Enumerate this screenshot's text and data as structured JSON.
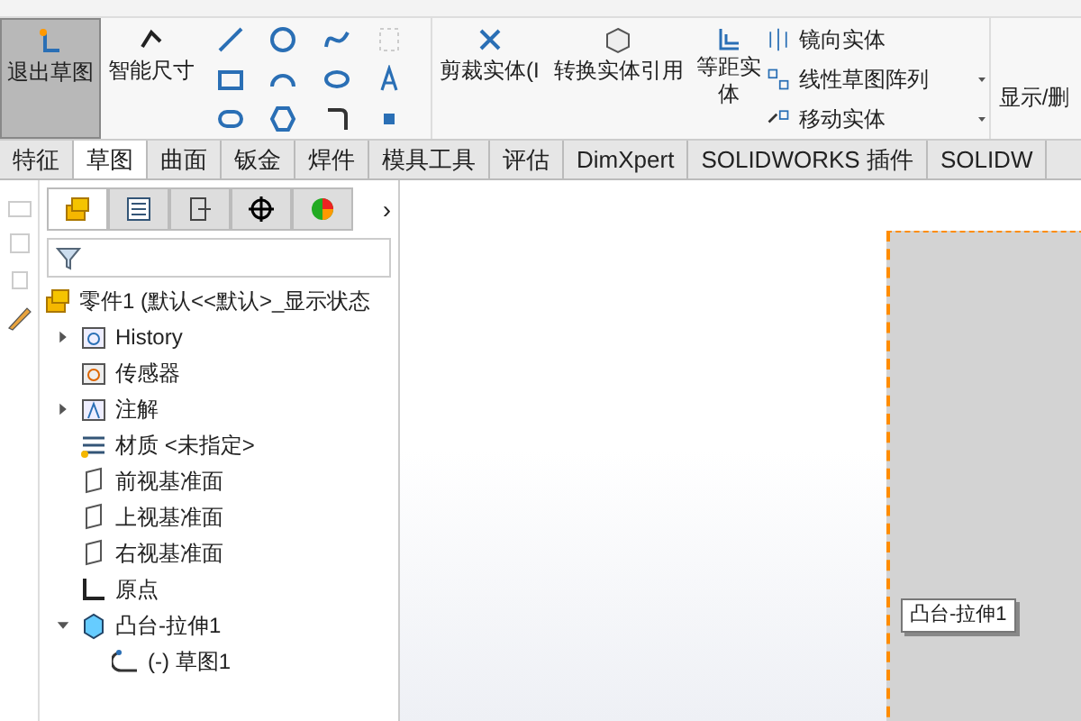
{
  "ribbon": {
    "large_buttons": [
      {
        "label": "退出草图",
        "selected": true
      },
      {
        "label": "智能尺寸",
        "selected": false
      }
    ],
    "commands": [
      {
        "label": "剪裁实体(I"
      },
      {
        "label": "转换实体引用"
      },
      {
        "label": "等距实体"
      }
    ],
    "small_commands": [
      {
        "label": "镜向实体",
        "dropdown": false
      },
      {
        "label": "线性草图阵列",
        "dropdown": true
      },
      {
        "label": "移动实体",
        "dropdown": true
      }
    ],
    "overflow": "显示/删"
  },
  "tabs": [
    {
      "label": "特征",
      "selected": false
    },
    {
      "label": "草图",
      "selected": true
    },
    {
      "label": "曲面",
      "selected": false
    },
    {
      "label": "钣金",
      "selected": false
    },
    {
      "label": "焊件",
      "selected": false
    },
    {
      "label": "模具工具",
      "selected": false
    },
    {
      "label": "评估",
      "selected": false
    },
    {
      "label": "DimXpert",
      "selected": false
    },
    {
      "label": "SOLIDWORKS 插件",
      "selected": false
    },
    {
      "label": "SOLIDW",
      "selected": false
    }
  ],
  "panel_tabs": [
    {
      "selected": true
    },
    {
      "selected": false
    },
    {
      "selected": false
    },
    {
      "selected": false
    },
    {
      "selected": false
    }
  ],
  "panel_overflow": "›",
  "tree": {
    "label": "零件1 (默认<<默认>_显示状态",
    "children": [
      {
        "label": "History",
        "kind": "history",
        "expanded": false
      },
      {
        "label": "传感器",
        "kind": "sensor"
      },
      {
        "label": "注解",
        "kind": "annotation",
        "expanded": false
      },
      {
        "label": "材质 <未指定>",
        "kind": "material"
      },
      {
        "label": "前视基准面",
        "kind": "plane"
      },
      {
        "label": "上视基准面",
        "kind": "plane"
      },
      {
        "label": "右视基准面",
        "kind": "plane"
      },
      {
        "label": "原点",
        "kind": "origin"
      },
      {
        "label": "凸台-拉伸1",
        "kind": "extrude",
        "expanded": true,
        "children": [
          {
            "label": "(-) 草图1",
            "kind": "sketch"
          }
        ]
      }
    ]
  },
  "tooltip": "凸台-拉伸1"
}
